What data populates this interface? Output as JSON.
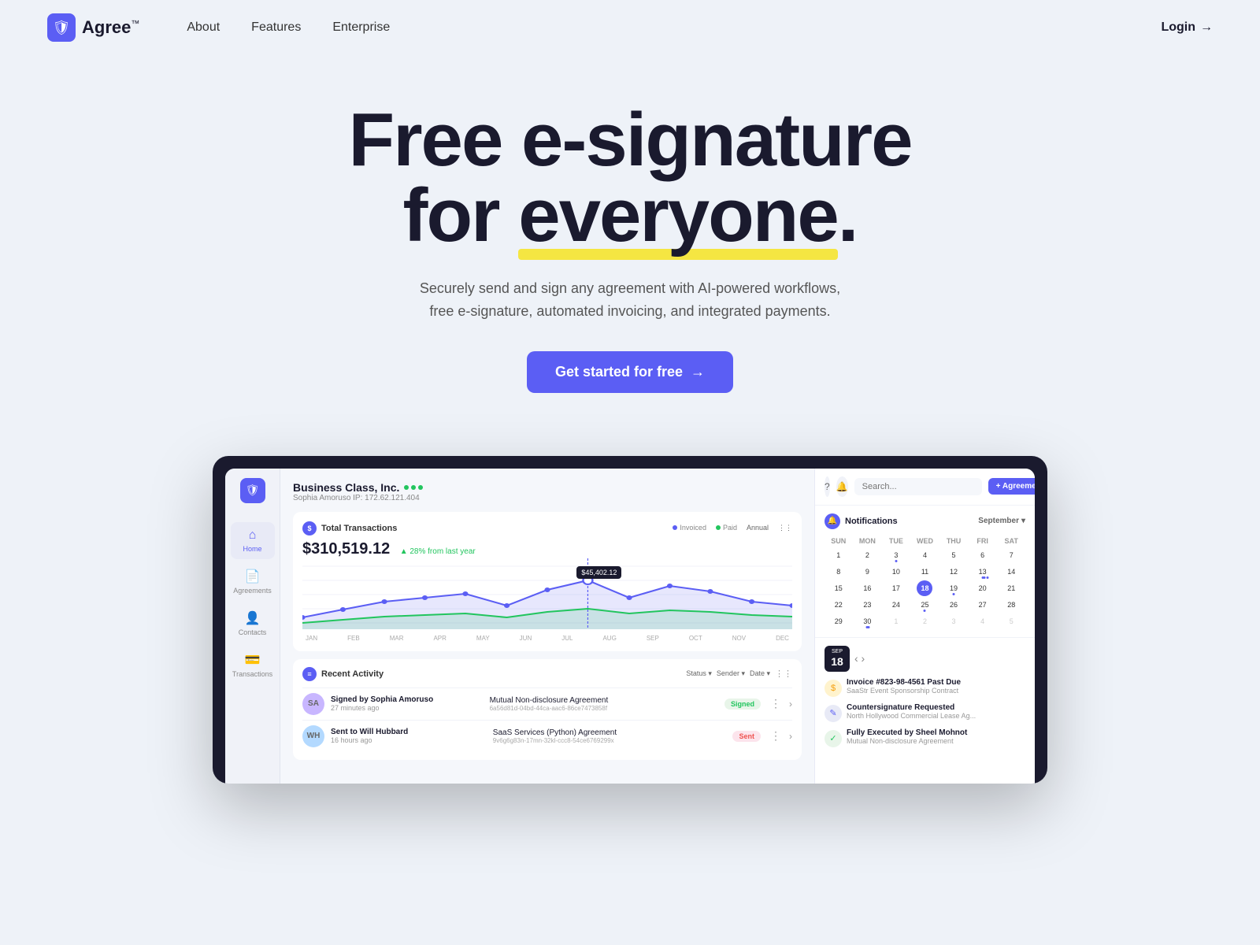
{
  "nav": {
    "logo_text": "Agree",
    "logo_tm": "™",
    "links": [
      "About",
      "Features",
      "Enterprise"
    ],
    "login_label": "Login",
    "login_arrow": "→"
  },
  "hero": {
    "line1": "Free e-signature",
    "line2_pre": "for ",
    "line2_highlight": "everyone",
    "line2_post": ".",
    "subtitle": "Securely send and sign any agreement with AI-powered workflows, free e-signature, automated invoicing, and integrated payments.",
    "cta_label": "Get started for free",
    "cta_arrow": "→"
  },
  "dashboard": {
    "company_name": "Business Class, Inc.",
    "company_sub": "Sophia Amoruso  IP: 172.62.121.404",
    "chart": {
      "title": "Total Transactions",
      "amount": "$310,519.12",
      "change": "▲ 28% from last year",
      "period": "Annual",
      "tooltip_value": "$45,402.12",
      "tooltip_month": "AUG",
      "xaxis": [
        "JAN",
        "FEB",
        "MAR",
        "APR",
        "MAY",
        "JUN",
        "JUL",
        "AUG",
        "SEP",
        "OCT",
        "NOV",
        "DEC"
      ],
      "legend_invoiced": "Invoiced",
      "legend_paid": "Paid"
    },
    "activity": {
      "title": "Recent Activity",
      "filters": [
        "Status ▾",
        "Sender ▾",
        "Date ▾"
      ],
      "rows": [
        {
          "avatar_initials": "SA",
          "avatar_color": "#c8b6ff",
          "name": "Signed by Sophia Amoruso",
          "time": "27 minutes ago",
          "doc_name": "Mutual Non-disclosure Agreement",
          "doc_hash": "6a56d81d-04bd-44ca-aac6-86ce7473858f",
          "status": "Signed",
          "status_class": "status-signed"
        },
        {
          "avatar_initials": "WH",
          "avatar_color": "#b3d9ff",
          "name": "Sent to Will Hubbard",
          "time": "16 hours ago",
          "doc_name": "SaaS Services (Python) Agreement",
          "doc_hash": "9v6g6g83n-17mn-32kl-ccc8-54ce6769299x",
          "status": "Sent",
          "status_class": "status-sent"
        }
      ]
    },
    "notifications": {
      "title": "Notifications",
      "month": "September",
      "calendar": {
        "day_headers": [
          "SUN",
          "MON",
          "TUE",
          "WED",
          "THU",
          "FRI",
          "SAT"
        ],
        "weeks": [
          [
            {
              "d": "",
              "other": true
            },
            {
              "d": "",
              "other": true
            },
            {
              "d": "",
              "other": true
            },
            {
              "d": "",
              "other": true
            },
            {
              "d": "",
              "other": true
            },
            {
              "d": "",
              "other": true
            },
            {
              "d": "",
              "other": true
            }
          ],
          [
            {
              "d": 1
            },
            {
              "d": 2
            },
            {
              "d": 3,
              "dot": true
            },
            {
              "d": 4
            },
            {
              "d": 5
            },
            {
              "d": 6
            },
            {
              "d": 7
            }
          ],
          [
            {
              "d": 8
            },
            {
              "d": 9
            },
            {
              "d": 10
            },
            {
              "d": 11
            },
            {
              "d": 12
            },
            {
              "d": 13,
              "dot": true,
              "dot_count": 3
            },
            {
              "d": 14
            }
          ],
          [
            {
              "d": 15
            },
            {
              "d": 16
            },
            {
              "d": 17
            },
            {
              "d": 18,
              "today": true
            },
            {
              "d": 19,
              "dot": true
            },
            {
              "d": 20
            },
            {
              "d": 21
            }
          ],
          [
            {
              "d": 22
            },
            {
              "d": 23
            },
            {
              "d": 24
            },
            {
              "d": 25,
              "dot": true
            },
            {
              "d": 26
            },
            {
              "d": 27
            },
            {
              "d": 28
            }
          ],
          [
            {
              "d": 29
            },
            {
              "d": 30,
              "dot": true,
              "dot_count": 2
            },
            {
              "d": 1,
              "other": true
            },
            {
              "d": 2,
              "other": true
            },
            {
              "d": 3,
              "other": true
            },
            {
              "d": 4,
              "other": true
            },
            {
              "d": 5,
              "other": true
            }
          ]
        ]
      },
      "date_block_day": "18",
      "date_block_month": "SEP",
      "notif_items": [
        {
          "icon_type": "invoice",
          "icon_char": "$",
          "title": "Invoice #823-98-4561 Past Due",
          "sub": "SaaStr Event Sponsorship Contract"
        },
        {
          "icon_type": "counter",
          "icon_char": "✎",
          "title": "Countersignature Requested",
          "sub": "North Hollywood Commercial Lease Ag..."
        },
        {
          "icon_type": "executed",
          "icon_char": "✓",
          "title": "Fully Executed by Sheel Mohnot",
          "sub": "Mutual Non-disclosure Agreement"
        }
      ]
    },
    "topbar": {
      "search_placeholder": "Search...",
      "add_label": "+ Agreement"
    },
    "nav_items": [
      {
        "label": "Home",
        "icon": "⌂",
        "active": true
      },
      {
        "label": "Agreements",
        "icon": "📄"
      },
      {
        "label": "Contacts",
        "icon": "👤"
      },
      {
        "label": "Transactions",
        "icon": "💳"
      }
    ]
  }
}
